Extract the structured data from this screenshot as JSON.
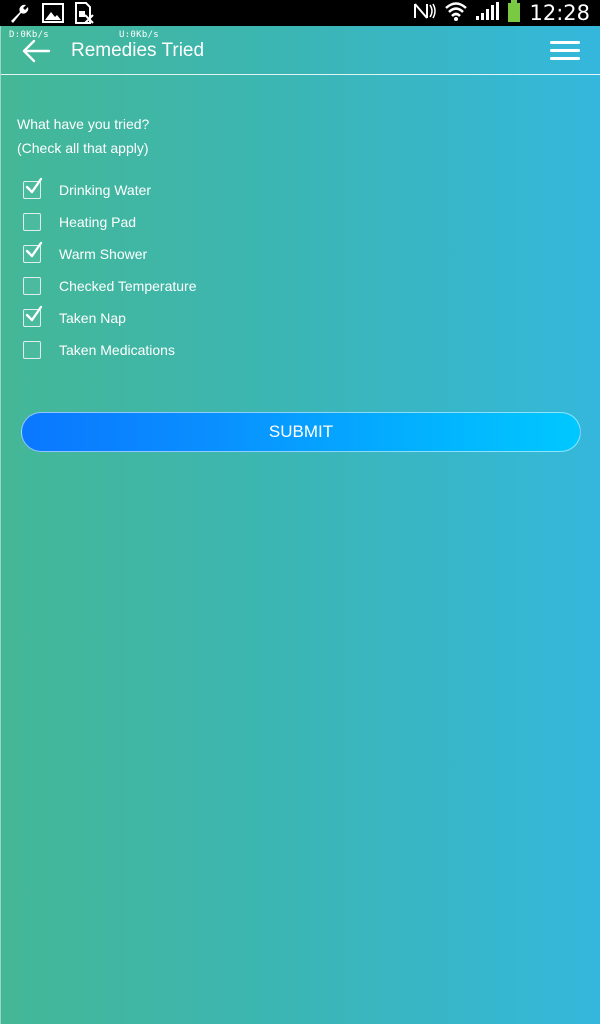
{
  "status_bar": {
    "time": "12:28",
    "icons_left": [
      "wrench-icon",
      "image-icon",
      "no-sim-icon"
    ],
    "icons_right": [
      "nfc-icon",
      "wifi-icon",
      "signal-icon",
      "battery-icon"
    ]
  },
  "net_speed": {
    "down": "D:0Kb/s",
    "up": "U:0Kb/s"
  },
  "header": {
    "title": "Remedies Tried"
  },
  "form": {
    "prompt_line1": "What have you tried?",
    "prompt_line2": "(Check all that apply)",
    "options": [
      {
        "label": "Drinking Water",
        "checked": true
      },
      {
        "label": "Heating Pad",
        "checked": false
      },
      {
        "label": "Warm Shower",
        "checked": true
      },
      {
        "label": "Checked Temperature",
        "checked": false
      },
      {
        "label": "Taken Nap",
        "checked": true
      },
      {
        "label": "Taken Medications",
        "checked": false
      }
    ],
    "submit_label": "SUBMIT"
  },
  "colors": {
    "gradient_start": "#44b796",
    "gradient_end": "#34b7dc",
    "button_start": "#0a77ff",
    "button_end": "#00c8ff",
    "battery": "#7ac943"
  }
}
